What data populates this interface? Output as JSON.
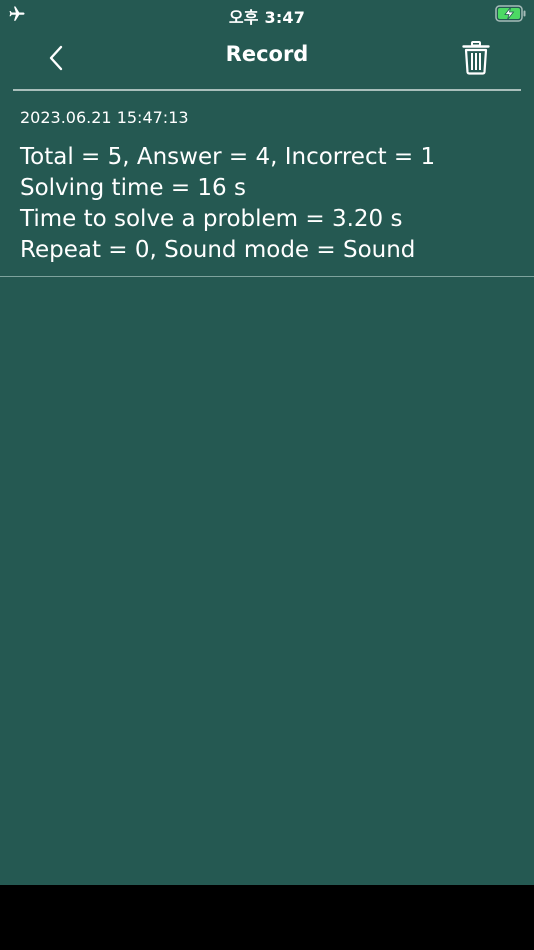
{
  "status_bar": {
    "time": "오후 3:47",
    "airplane_icon": "airplane-icon",
    "battery_icon": "battery-charging-icon",
    "battery_color": "#4cd964"
  },
  "nav": {
    "title": "Record",
    "back_icon": "chevron-left-icon",
    "delete_icon": "trash-icon"
  },
  "records": [
    {
      "date": "2023.06.21 15:47:13",
      "lines": [
        "Total = 5, Answer = 4, Incorrect = 1",
        "Solving time = 16 s",
        "Time to solve a problem = 3.20 s",
        "Repeat = 0, Sound mode = Sound"
      ]
    }
  ],
  "colors": {
    "background": "#255952",
    "text": "#ffffff",
    "divider": "#a9bfbb"
  }
}
